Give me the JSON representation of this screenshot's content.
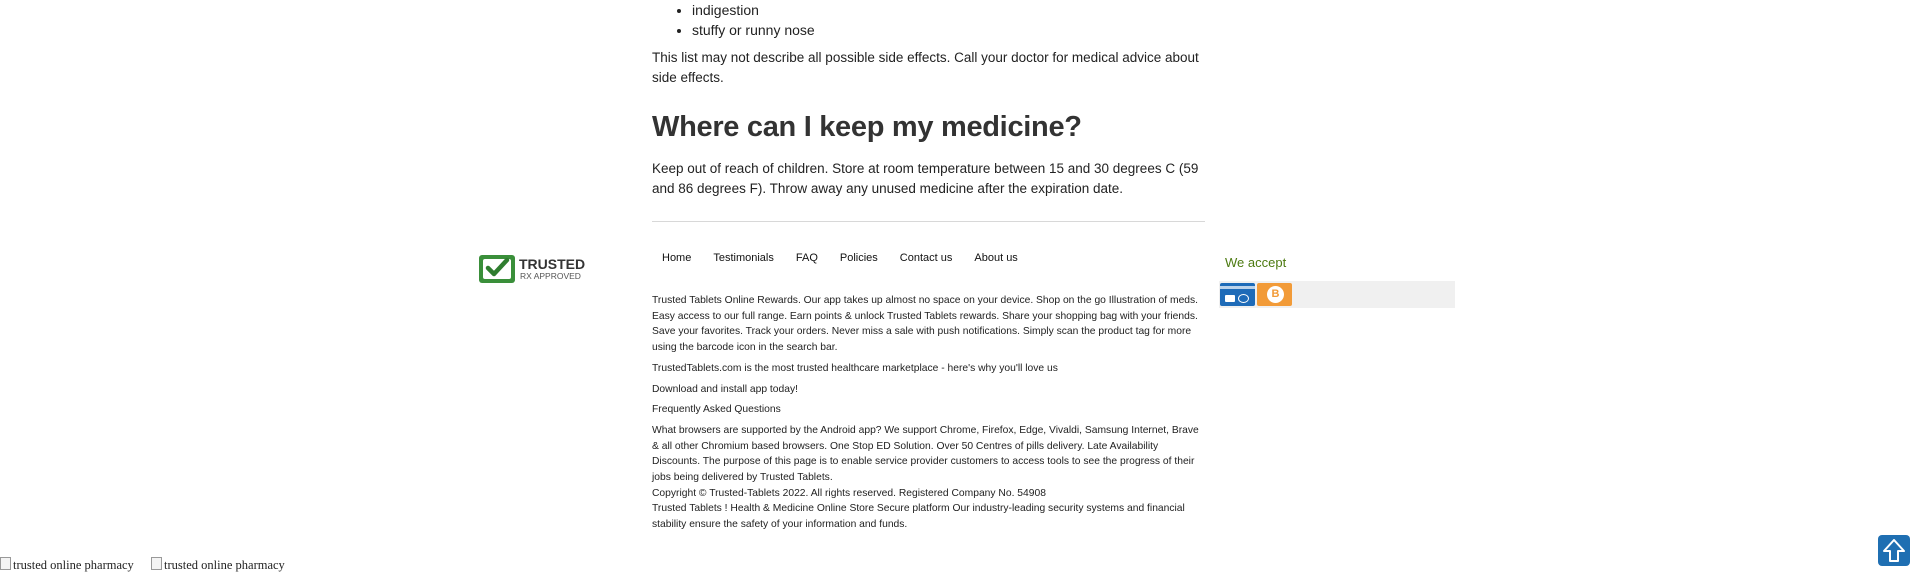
{
  "side_effects": {
    "items": [
      "indigestion",
      "stuffy or runny nose"
    ],
    "note": "This list may not describe all possible side effects. Call your doctor for medical advice about side effects."
  },
  "storage": {
    "heading": "Where can I keep my medicine?",
    "text": "Keep out of reach of children. Store at room temperature between 15 and 30 degrees C (59 and 86 degrees F). Throw away any unused medicine after the expiration date."
  },
  "logo": {
    "title": "TRUSTED",
    "subtitle": "RX APPROVED",
    "icon": "checkmark-shield-icon",
    "color": "#3a8f3a"
  },
  "nav": [
    "Home",
    "Testimonials",
    "FAQ",
    "Policies",
    "Contact us",
    "About us"
  ],
  "footer": {
    "rewards": "Trusted Tablets Online Rewards. Our app takes up almost no space on your device. Shop on the go Illustration of meds. Easy access to our full range. Earn points & unlock Trusted Tablets rewards. Share your shopping bag with your friends. Save your favorites. Track your orders. Never miss a sale with push notifications. Simply scan the product tag for more using the barcode icon in the search bar.",
    "trusted": "TrustedTablets.com is the most trusted healthcare marketplace - here's why you'll love us",
    "download": "Download and install app today!",
    "faq": "Frequently Asked Questions",
    "browsers": "What browsers are supported by the Android app? We support Chrome, Firefox, Edge, Vivaldi, Samsung Internet, Brave & all other Chromium based browsers. One Stop ED Solution. Over 50 Centres of pills delivery. Late Availability Discounts. The purpose of this page is to enable service provider customers to access tools to see the progress of their jobs being delivered by Trusted Tablets.",
    "copyright": "Copyright © Trusted-Tablets 2022. All rights reserved. Registered Company No. 54908",
    "security": "Trusted Tablets ! Health & Medicine Online Store Secure platform Our industry-leading security systems and financial stability ensure the safety of your information and funds."
  },
  "payments": {
    "title": "We accept",
    "methods": [
      {
        "label": "BANK CARD",
        "icon": "bank-card-icon",
        "color": "#1e6bb8"
      },
      {
        "label": "B",
        "icon": "bitcoin-icon",
        "color": "#f29b38"
      }
    ]
  },
  "broken_images": [
    "trusted online pharmacy",
    "trusted online pharmacy"
  ],
  "scroll_top": {
    "icon": "arrow-up-icon",
    "color": "#1f6fb2"
  }
}
